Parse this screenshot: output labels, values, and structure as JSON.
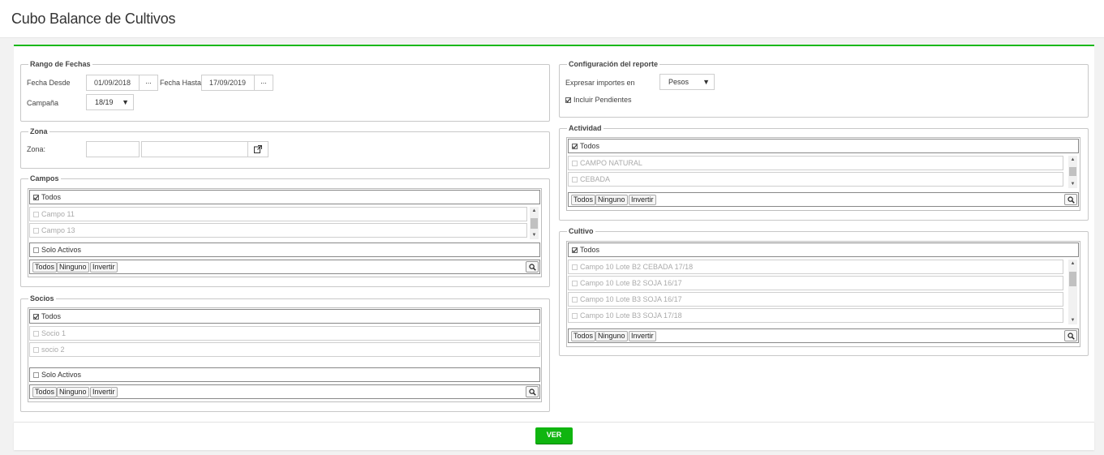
{
  "page": {
    "title": "Cubo Balance de Cultivos"
  },
  "fechas": {
    "legend": "Rango de Fechas",
    "desde_label": "Fecha Desde",
    "desde_value": "01/09/2018",
    "hasta_label": "Fecha Hasta",
    "hasta_value": "17/09/2019",
    "dots": "...",
    "campana_label": "Campaña",
    "campana_value": "18/19"
  },
  "zona": {
    "legend": "Zona",
    "label": "Zona:",
    "code": "",
    "name": ""
  },
  "campos": {
    "legend": "Campos",
    "all": "Todos",
    "items": [
      "Campo 11",
      "Campo 13"
    ],
    "solo_activos": "Solo Activos"
  },
  "socios": {
    "legend": "Socios",
    "all": "Todos",
    "items": [
      "Socio 1",
      "socio 2"
    ],
    "solo_activos": "Solo Activos"
  },
  "toolbar": {
    "todos": "Todos",
    "ninguno": "Ninguno",
    "invertir": "Invertir"
  },
  "config": {
    "legend": "Configuración del reporte",
    "importes_label": "Expresar importes en",
    "importes_value": "Pesos",
    "pendientes_label": "Incluir Pendientes"
  },
  "actividad": {
    "legend": "Actividad",
    "all": "Todos",
    "items": [
      "CAMPO NATURAL",
      "CEBADA"
    ]
  },
  "cultivo": {
    "legend": "Cultivo",
    "all": "Todos",
    "items": [
      "Campo 10 Lote B2 CEBADA 17/18",
      "Campo 10 Lote B2 SOJA 16/17",
      "Campo 10 Lote B3 SOJA 16/17",
      "Campo 10 Lote B3 SOJA 17/18"
    ]
  },
  "actions": {
    "ver": "VER"
  },
  "colors": {
    "accent": "#1ab81a",
    "button": "#10b510"
  }
}
